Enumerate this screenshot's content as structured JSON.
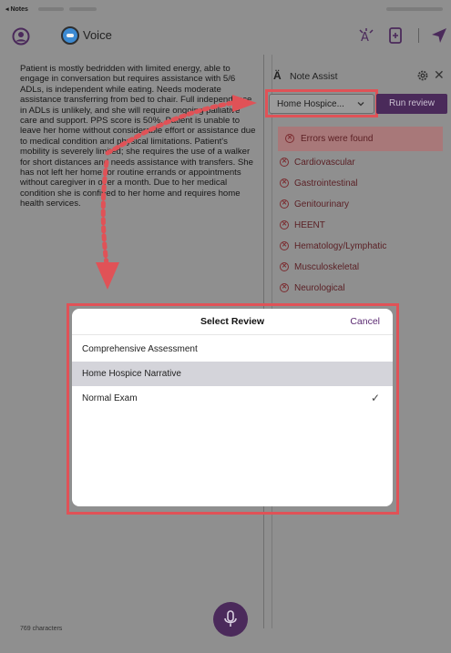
{
  "status_bar": {
    "back_label": "◂ Notes"
  },
  "top_bar": {
    "voice_label": "Voice"
  },
  "note": {
    "text": "Patient is mostly bedridden with limited energy, able to engage in conversation but requires assistance with 5/6 ADLs, is independent while eating. Needs moderate assistance transferring from bed to chair. Full independence in ADLs is unlikely, and she will require ongoing palliative care and support. PPS score is 50%. Patient is unable to leave her home without considerable effort or assistance due to medical condition and physical limitations. Patient's mobility is severely limited; she requires the use of a walker for short distances and needs assistance with transfers. She has not left her home for routine errands or appointments without caregiver in over a month. Due to her medical condition she is confined to her home and requires home health services.",
    "char_count": "769 characters"
  },
  "note_assist": {
    "title": "Note Assist",
    "selected_review": "Home Hospice...",
    "run_review_label": "Run review",
    "errors_banner": "Errors were found",
    "error_items": [
      "Cardiovascular",
      "Gastrointestinal",
      "Genitourinary",
      "HEENT",
      "Hematology/Lymphatic",
      "Musculoskeletal",
      "Neurological"
    ]
  },
  "select_review_modal": {
    "title": "Select Review",
    "cancel_label": "Cancel",
    "options": [
      "Comprehensive Assessment",
      "Home Hospice Narrative",
      "Normal Exam"
    ],
    "highlighted_option": "Home Hospice Narrative",
    "checked_option": "Normal Exam",
    "check_glyph": "✓"
  },
  "colors": {
    "annotation_red": "#e05257",
    "brand_purple": "#4a2a5a",
    "error_text": "#5a1f24"
  }
}
